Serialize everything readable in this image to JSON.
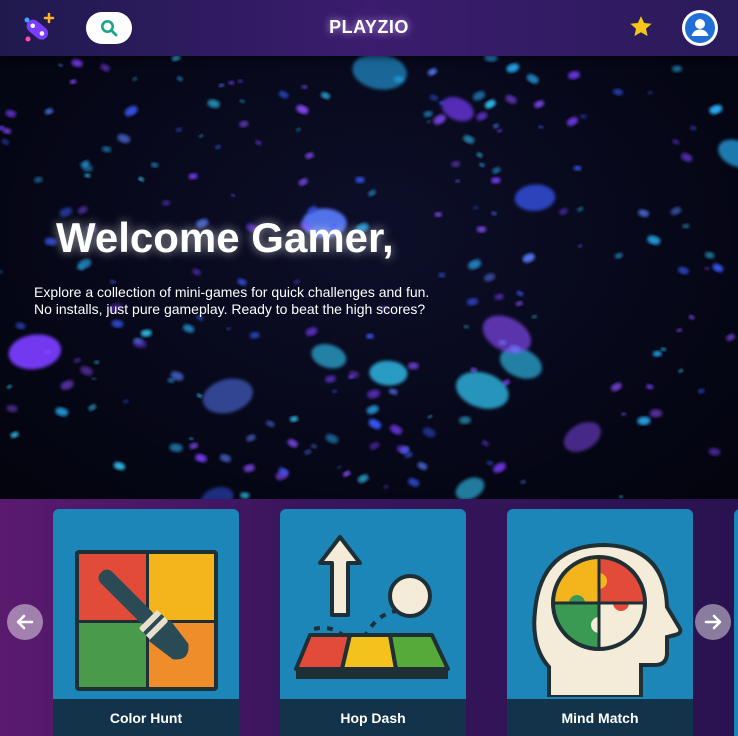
{
  "header": {
    "brand": "PLAYZIO",
    "icons": {
      "logo": "gamepad-plus-icon",
      "search": "search-icon",
      "favorites": "star-icon",
      "profile": "user-icon"
    },
    "colors": {
      "search_icon": "#1aa38a",
      "star": "#f5c518",
      "avatar": "#1f6fd6"
    }
  },
  "hero": {
    "title": "Welcome Gamer,",
    "description": "Explore a collection of mini-games for quick challenges and fun. No installs, just pure gameplay. Ready to beat the high scores?"
  },
  "carousel": {
    "prev_icon": "arrow-left-icon",
    "next_icon": "arrow-right-icon",
    "games": [
      {
        "title": "Color Hunt",
        "icon": "paint-brush-grid-icon"
      },
      {
        "title": "Hop Dash",
        "icon": "jump-ball-icon"
      },
      {
        "title": "Mind Match",
        "icon": "puzzle-head-icon"
      }
    ]
  }
}
